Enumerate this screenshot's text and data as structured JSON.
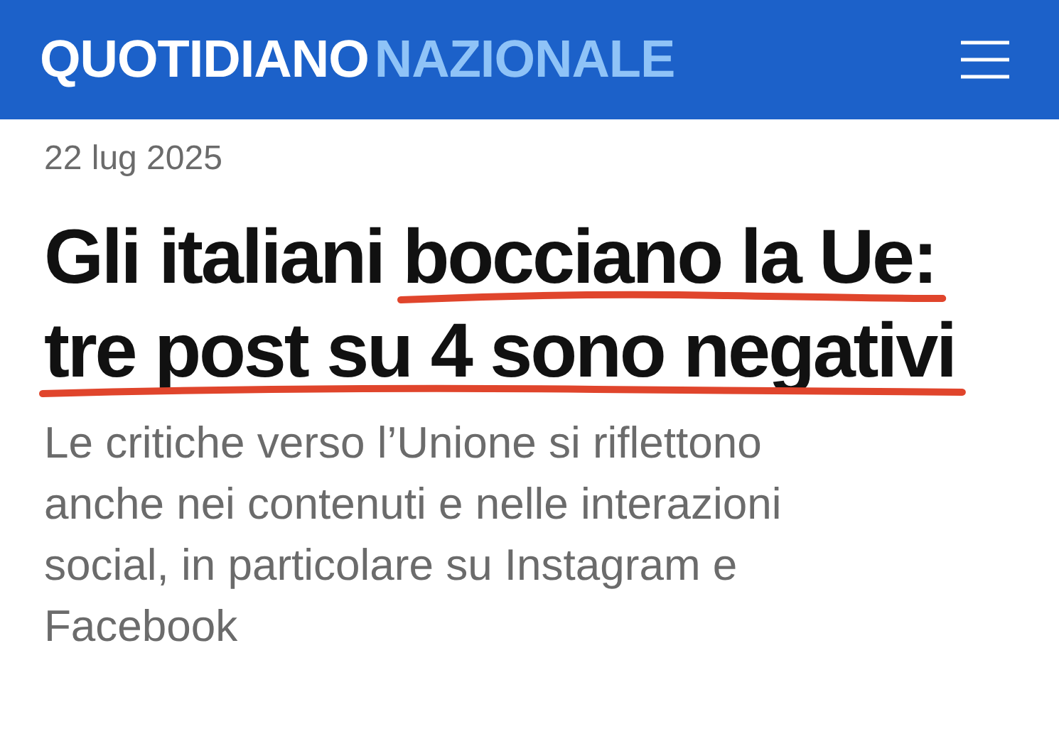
{
  "header": {
    "logo": [
      "QUOTIDIANO",
      "NAZIONALE"
    ]
  },
  "article": {
    "date": "22 lug 2025",
    "headline": [
      {
        "text": "Gli italiani ",
        "underlined": false
      },
      {
        "text": "bocciano la Ue: tre post su 4 sono negativi",
        "underlined": true
      }
    ],
    "subtitle": "Le critiche verso l’Unione si riflettono anche nei contenuti e nelle interazioni social, in particolare su Instagram e Facebook"
  }
}
